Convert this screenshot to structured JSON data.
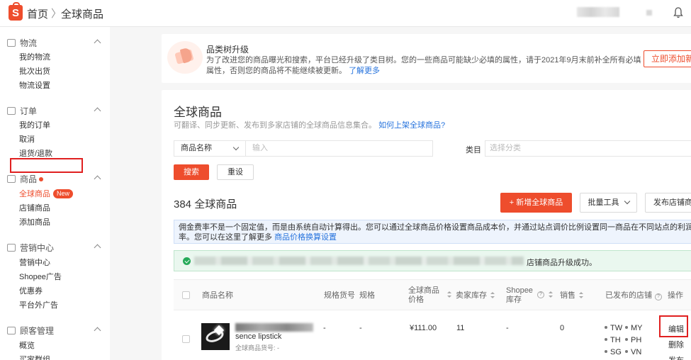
{
  "header": {
    "logo_letter": "S",
    "breadcrumb_home": "首页",
    "breadcrumb_sep": "〉",
    "breadcrumb_current": "全球商品"
  },
  "sidebar": {
    "sections": [
      {
        "title": "物流",
        "icon": "truck-icon",
        "items": [
          "我的物流",
          "批次出货",
          "物流设置"
        ]
      },
      {
        "title": "订单",
        "icon": "clipboard-icon",
        "items": [
          "我的订单",
          "取消",
          "退货/退款"
        ]
      },
      {
        "title": "商品",
        "icon": "box-icon",
        "items": [
          "全球商品",
          "店铺商品",
          "添加商品"
        ]
      },
      {
        "title": "营销中心",
        "icon": "tag-icon",
        "items": [
          "营销中心",
          "Shopee广告",
          "优惠券",
          "平台外广告"
        ]
      },
      {
        "title": "顾客管理",
        "icon": "people-icon",
        "items": [
          "概览",
          "买家群组"
        ]
      }
    ],
    "new_badge": "New"
  },
  "banner": {
    "title": "品类树升级",
    "text": "为了改进您的商品曝光和搜索，平台已经升级了类目树。您的一些商品可能缺少必填的属性，请于2021年9月末前补全所有必填属性，否则您的商品将不能继续被更新。",
    "link": "了解更多",
    "button": "立即添加新属性"
  },
  "main": {
    "title": "全球商品",
    "subtitle": "可翻译、同步更新、发布到多家店铺的全球商品信息集合。",
    "subtitle_link": "如何上架全球商品?",
    "filter": {
      "select_value": "商品名称",
      "input_placeholder": "输入",
      "category_label": "类目",
      "category_placeholder": "选择分类",
      "search_button": "搜索",
      "reset_button": "重设"
    },
    "count_title": "384 全球商品",
    "add_button": "+ 新增全球商品",
    "bulk_button": "批量工具",
    "publish_button": "发布店铺商品",
    "info_text": "佣金费率不是一个固定值，而是由系统自动计算得出。您可以通过全球商品价格设置商品成本价，并通过站点调价比例设置同一商品在不同站点的利润率。您可以在这里了解更多",
    "info_link": "商品价格换算设置",
    "success_text": "店铺商品升级成功。"
  },
  "table": {
    "headers": {
      "name": "商品名称",
      "sku": "规格货号",
      "spec": "规格",
      "price": "全球商品价格",
      "stock": "卖家库存",
      "shopee_stock": "Shopee库存",
      "sales": "销售",
      "shops": "已发布的店铺",
      "action": "操作"
    },
    "rows": [
      {
        "name_visible": "sence lipstick",
        "sku_label": "全球商品货号: -",
        "sku": "-",
        "spec": "-",
        "price": "¥111.00",
        "stock": "11",
        "shopee_stock": "-",
        "sales": "0",
        "shops": [
          "TW",
          "MY",
          "TH",
          "PH",
          "SG",
          "VN"
        ],
        "actions": [
          "编辑",
          "删除",
          "发布"
        ]
      }
    ]
  }
}
